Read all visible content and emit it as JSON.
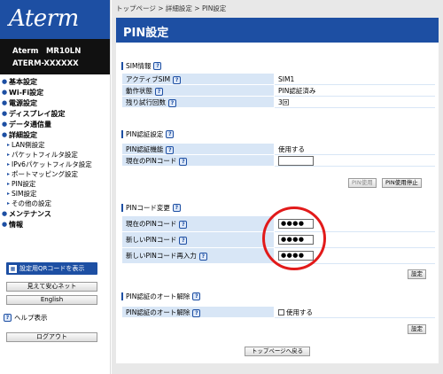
{
  "brand": {
    "logo": "Aterm",
    "model_line1": "Aterm　MR10LN",
    "model_line2": "ATERM-XXXXXX"
  },
  "menu": [
    {
      "label": "基本設定"
    },
    {
      "label": "Wi-Fi設定"
    },
    {
      "label": "電源設定"
    },
    {
      "label": "ディスプレイ設定"
    },
    {
      "label": "データ通信量"
    },
    {
      "label": "詳細設定"
    }
  ],
  "submenu": [
    "LAN側設定",
    "パケットフィルタ設定",
    "IPv6パケットフィルタ設定",
    "ポートマッピング設定",
    "PIN設定",
    "SIM設定",
    "その他の設定"
  ],
  "menu2": [
    {
      "label": "メンテナンス"
    },
    {
      "label": "情報"
    }
  ],
  "sidebar_buttons": {
    "qr": "設定用QRコードを表示",
    "safe": "見えて安心ネット",
    "english": "English",
    "help": "ヘルプ表示",
    "logout": "ログアウト"
  },
  "breadcrumb": "トップページ > 詳細設定 > PIN設定",
  "page_title": "PIN設定",
  "sim_info": {
    "heading": "SIM情報",
    "rows": [
      {
        "label": "アクティブSIM",
        "value": "SIM1"
      },
      {
        "label": "動作状態",
        "value": "PIN認証済み"
      },
      {
        "label": "残り試行回数",
        "value": "3回"
      }
    ]
  },
  "pin_auth": {
    "heading": "PIN認証設定",
    "function_label": "PIN認証機能",
    "function_value": "使用する",
    "current_label": "現在のPINコード",
    "btn_use": "PIN使用",
    "btn_stop": "PIN使用停止"
  },
  "pin_change": {
    "heading": "PINコード変更",
    "rows": [
      {
        "label": "現在のPINコード",
        "value": "●●●●"
      },
      {
        "label": "新しいPINコード",
        "value": "●●●●"
      },
      {
        "label": "新しいPINコード再入力",
        "value": "●●●●"
      }
    ],
    "btn_set": "設定"
  },
  "auto_release": {
    "heading": "PIN認証のオート解除",
    "label": "PIN認証のオート解除",
    "checkbox_label": "使用する",
    "checked": false,
    "btn_set": "設定"
  },
  "back_button": "トップページへ戻る",
  "help_mark": "?",
  "colors": {
    "accent": "#1d4fa3",
    "highlight_circle": "#e21a1a",
    "label_bg": "#d8e6f6"
  }
}
